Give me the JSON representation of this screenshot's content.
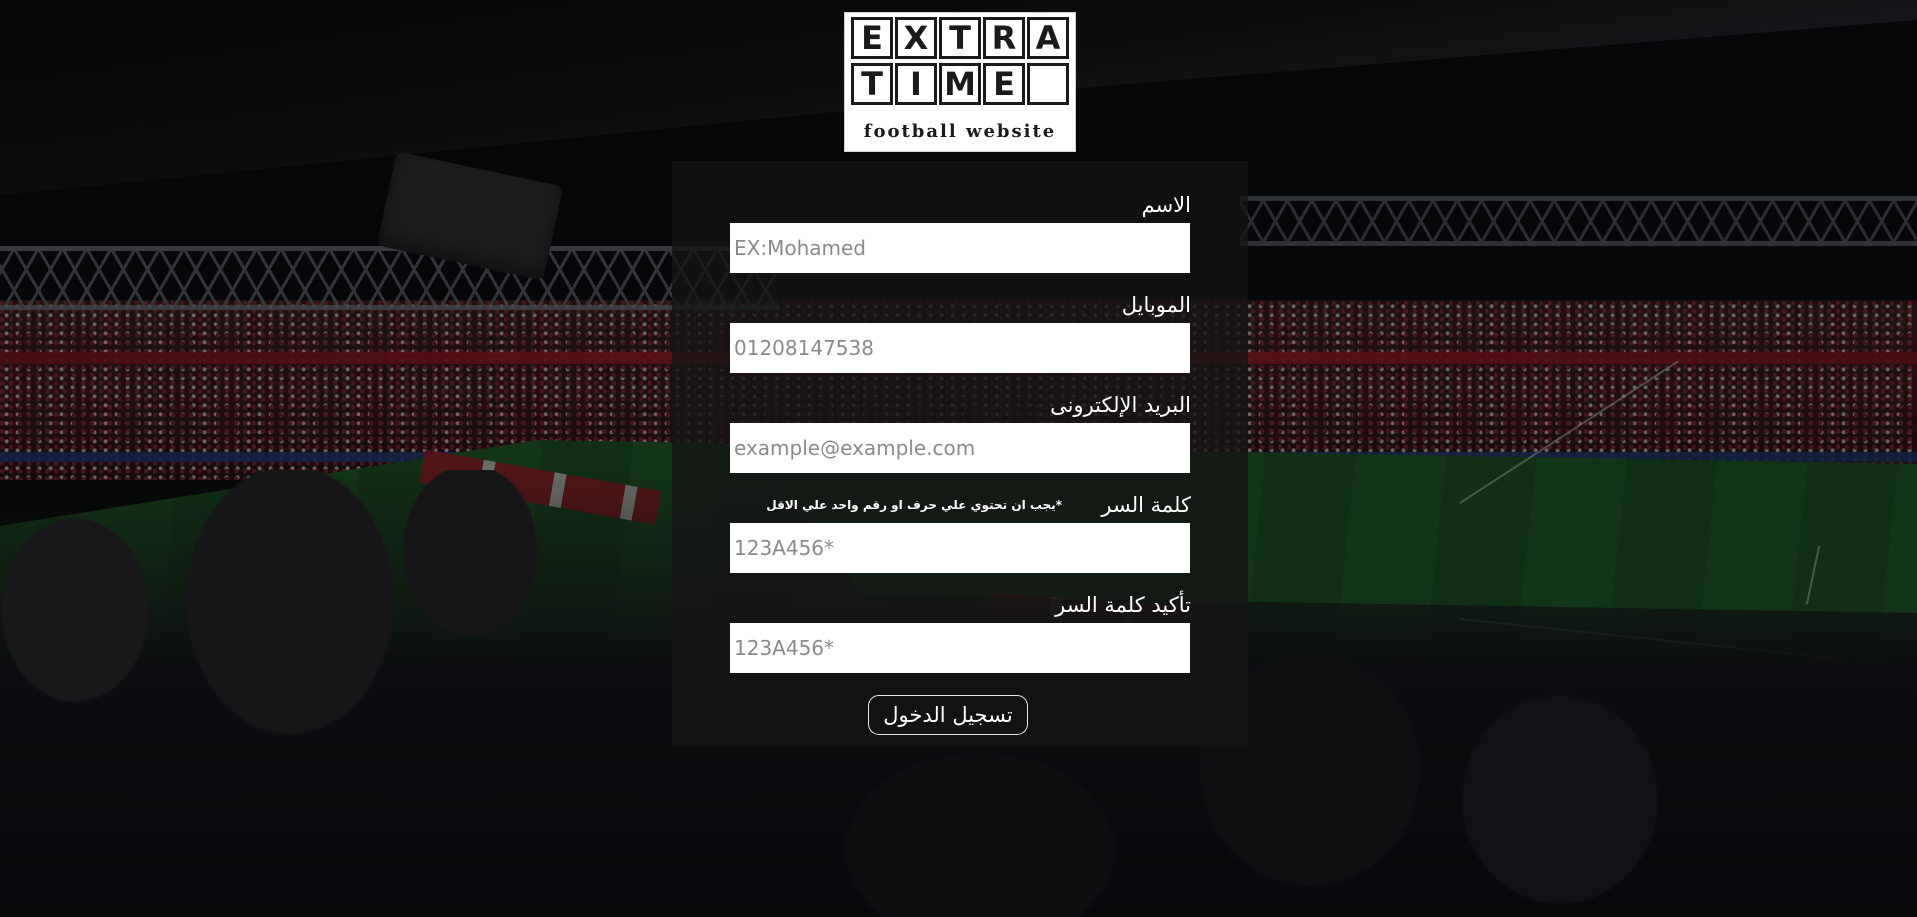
{
  "logo": {
    "row1": [
      "E",
      "X",
      "T",
      "R",
      "A"
    ],
    "row2": [
      "T",
      "I",
      "M",
      "E",
      ""
    ],
    "tagline": "football website"
  },
  "form": {
    "fields": [
      {
        "label": "الاسم",
        "placeholder": "EX:Mohamed",
        "type": "text"
      },
      {
        "label": "الموبايل",
        "placeholder": "01208147538",
        "type": "tel"
      },
      {
        "label": "البريد الإلكترونى",
        "placeholder": "example@example.com",
        "type": "email"
      },
      {
        "label": "كلمة السر",
        "placeholder": "123A456*",
        "type": "password",
        "hint": "*يجب ان تحتوي علي حرف او رقم واحد علي الاقل"
      },
      {
        "label": "تأكيد كلمة السر",
        "placeholder": "123A456*",
        "type": "password"
      }
    ],
    "submit_label": "تسجيل الدخول"
  },
  "colors": {
    "panel": "#141414",
    "text": "#ffffff",
    "input_bg": "#ffffff",
    "placeholder": "#8a8a8a",
    "club_red": "#b3202b"
  }
}
